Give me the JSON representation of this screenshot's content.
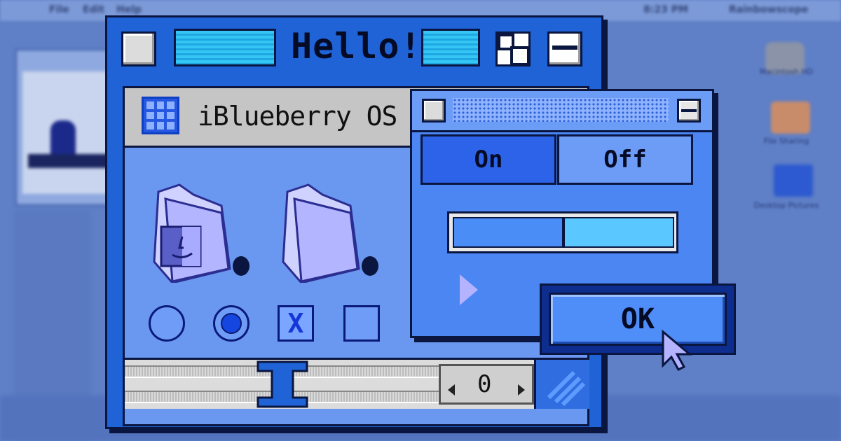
{
  "menubar": {
    "items": [
      "File",
      "Edit",
      "Help"
    ],
    "clock": "8:23 PM",
    "app_name": "Rainbowscope"
  },
  "desktop": {
    "icons": [
      {
        "label": "Macintosh HD",
        "icon": "hard-drive-icon"
      },
      {
        "label": "File Sharing",
        "icon": "file-sharing-icon"
      },
      {
        "label": "Desktop Pictures",
        "icon": "folder-icon"
      }
    ]
  },
  "main_window": {
    "title": "Hello!",
    "header_text": "iBlueberry OS",
    "icons": [
      "finder-folder-icon",
      "folder-icon"
    ],
    "controls": {
      "radio_1_selected": false,
      "radio_2_selected": true,
      "checkbox_1_checked": true,
      "checkbox_1_mark": "X",
      "checkbox_2_checked": false
    },
    "stepper_value": "0"
  },
  "dialog": {
    "toggle_on_label": "On",
    "toggle_off_label": "Off",
    "toggle_selected": "On",
    "progress_fraction": 0.5,
    "ok_label": "OK"
  },
  "colors": {
    "accent": "#1f63d6",
    "background": "#5f7fc6",
    "highlight": "#35c6f4"
  }
}
